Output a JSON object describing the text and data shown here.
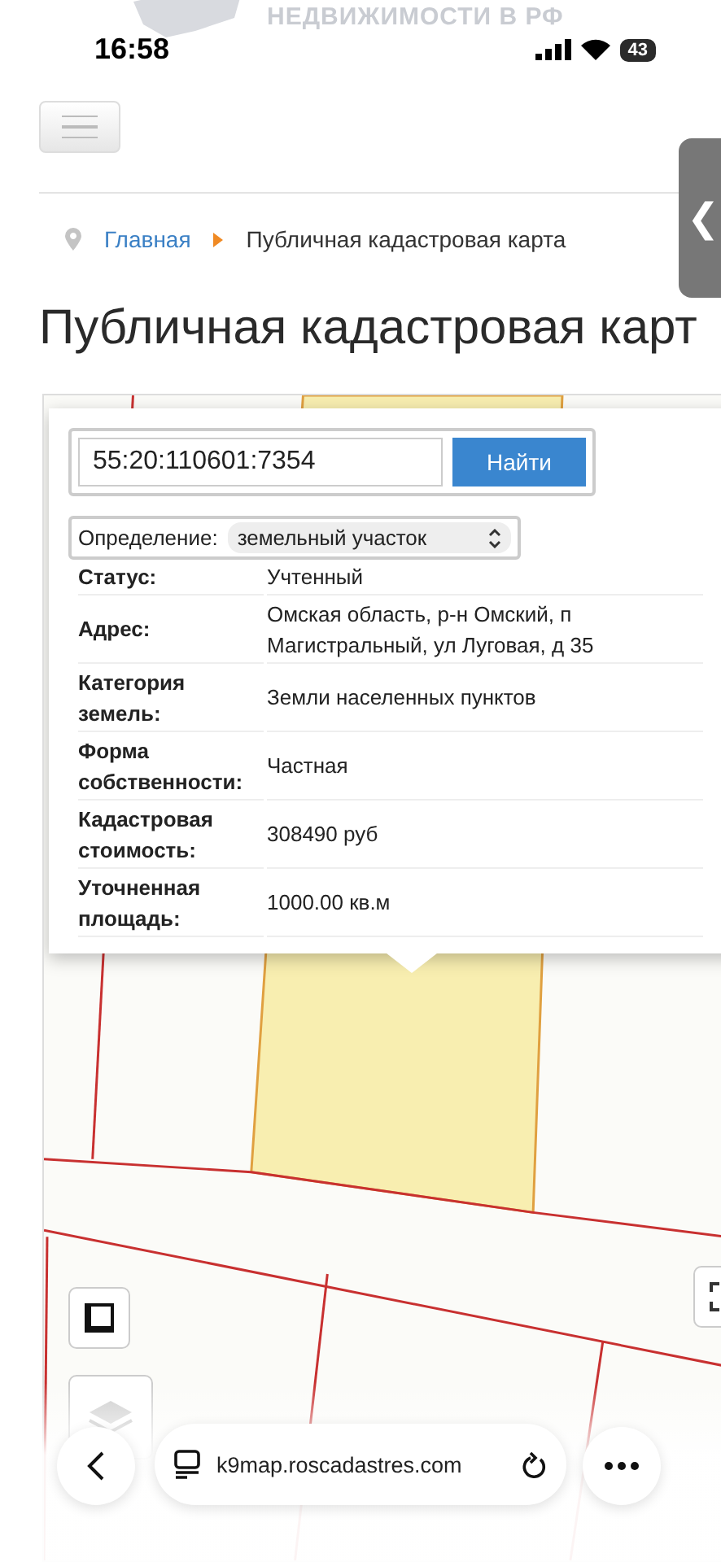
{
  "header_logo": {
    "text": "НЕДВИЖИМОСТИ В РФ"
  },
  "status_bar": {
    "time": "16:58",
    "battery": "43"
  },
  "breadcrumb": [
    {
      "label": "Главная",
      "kind": "link"
    },
    {
      "label": "Публичная кадастровая карта",
      "kind": "current"
    }
  ],
  "page_title": "Публичная кадастровая карт",
  "search": {
    "value": "55:20:110601:7354",
    "button": "Найти"
  },
  "definition": {
    "label": "Определение:",
    "value": "земельный участок"
  },
  "details": [
    {
      "label": "Статус:",
      "value": "Учтенный"
    },
    {
      "label": "Адрес:",
      "value": "Омская область, р-н Омский, п Магистральный, ул Луговая, д 35"
    },
    {
      "label": "Категория земель:",
      "value": "Земли населенных пунктов"
    },
    {
      "label": "Форма собственности:",
      "value": "Частная"
    },
    {
      "label": "Кадастровая стоимость:",
      "value": "308490 руб"
    },
    {
      "label": "Уточненная площадь:",
      "value": "1000.00 кв.м"
    }
  ],
  "browser": {
    "url": "k9map.roscadastres.com"
  },
  "side_toggle": "❮"
}
